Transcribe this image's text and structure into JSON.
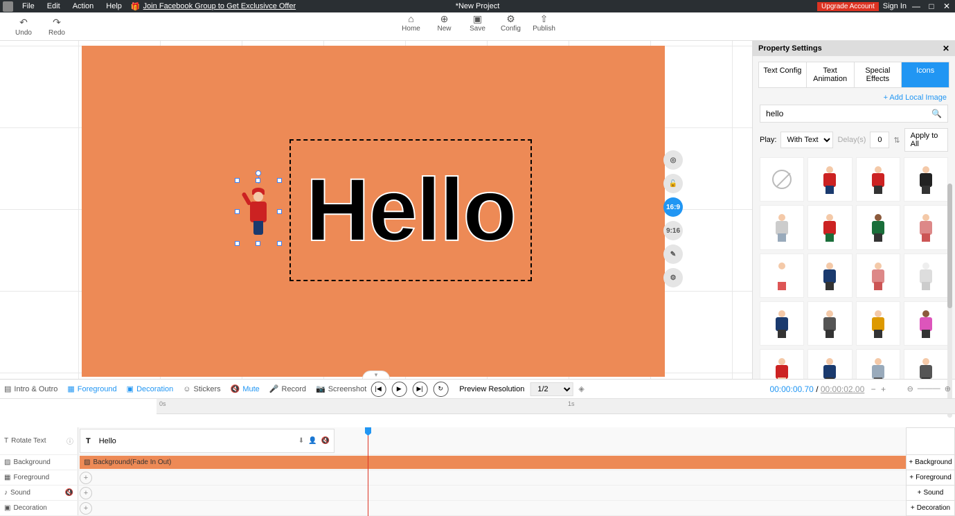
{
  "menubar": {
    "items": [
      "File",
      "Edit",
      "Action",
      "Help"
    ],
    "fb_offer": "Join Facebook Group to Get Exclusivce Offer",
    "title": "*New Project",
    "upgrade": "Upgrade Account",
    "signin": "Sign In"
  },
  "toolbar": {
    "undo": "Undo",
    "redo": "Redo",
    "home": "Home",
    "new": "New",
    "save": "Save",
    "config": "Config",
    "publish": "Publish"
  },
  "canvas": {
    "hello": "Hello",
    "ratio1": "16:9",
    "ratio2": "9:16"
  },
  "prop": {
    "header": "Property Settings",
    "tabs": [
      "Text Config",
      "Text Animation",
      "Special Effects",
      "Icons"
    ],
    "active_tab": 3,
    "add_local": "+  Add Local Image",
    "search": "hello",
    "play_label": "Play:",
    "play_mode": "With Text",
    "delay_label": "Delay(s)",
    "delay_val": "0",
    "apply_all": "Apply to All",
    "icons": [
      {
        "type": "none"
      },
      {
        "head": "#f4c9a8",
        "body": "#c22",
        "legs": "#1a3a6e"
      },
      {
        "head": "#f4c9a8",
        "body": "#c22",
        "legs": "#333"
      },
      {
        "head": "#f4c9a8",
        "body": "#222",
        "legs": "#333"
      },
      {
        "head": "#f4c9a8",
        "body": "#ccc",
        "legs": "#9ab"
      },
      {
        "head": "#f4c9a8",
        "body": "#c22",
        "legs": "#1a6e3a"
      },
      {
        "head": "#8b5a3c",
        "body": "#1a6e3a",
        "legs": "#333"
      },
      {
        "head": "#f4c9a8",
        "body": "#d88",
        "legs": "#c55"
      },
      {
        "head": "#f4c9a8",
        "body": "#fff",
        "legs": "#d55"
      },
      {
        "head": "#f4c9a8",
        "body": "#1a3a6e",
        "legs": "#333"
      },
      {
        "head": "#f4c9a8",
        "body": "#d88",
        "legs": "#c55"
      },
      {
        "head": "#eee",
        "body": "#ddd",
        "legs": "#ccc"
      },
      {
        "head": "#f4c9a8",
        "body": "#1a3a6e",
        "legs": "#333"
      },
      {
        "head": "#f4c9a8",
        "body": "#555",
        "legs": "#333"
      },
      {
        "head": "#f4c9a8",
        "body": "#d90",
        "legs": "#333"
      },
      {
        "head": "#8b5a3c",
        "body": "#d5b",
        "legs": "#333"
      },
      {
        "head": "#f4c9a8",
        "body": "#c22",
        "legs": "#f4c9a8"
      },
      {
        "head": "#f4c9a8",
        "body": "#1a3a6e",
        "legs": "#333"
      },
      {
        "head": "#f4c9a8",
        "body": "#9ab",
        "legs": "#555"
      },
      {
        "head": "#f4c9a8",
        "body": "#555",
        "legs": "#333"
      }
    ]
  },
  "timeline": {
    "intro_outro": "Intro & Outro",
    "foreground": "Foreground",
    "decoration": "Decoration",
    "stickers": "Stickers",
    "mute": "Mute",
    "record": "Record",
    "screenshot": "Screenshot",
    "preview_res": "Preview Resolution",
    "res_val": "1/2",
    "time_cur": "00:00:00.70",
    "time_total": "00:00:02.00",
    "ruler_0s": "0s",
    "ruler_1s": "1s",
    "tracks": {
      "rotate_text": "Rotate Text",
      "hello_clip": "Hello",
      "background": "Background",
      "bg_clip": "Background(Fade In Out)",
      "foreground": "Foreground",
      "sound": "Sound",
      "decoration": "Decoration"
    },
    "add_buttons": [
      "Background",
      "Foreground",
      "Sound",
      "Decoration"
    ]
  }
}
